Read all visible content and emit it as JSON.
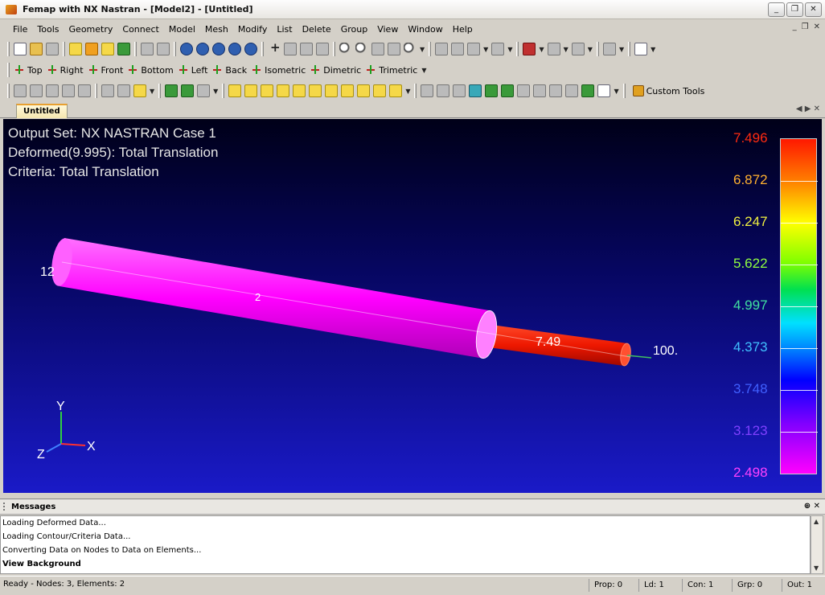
{
  "window": {
    "title": "Femap with NX Nastran - [Model2] - [Untitled]"
  },
  "menu": [
    "File",
    "Tools",
    "Geometry",
    "Connect",
    "Model",
    "Mesh",
    "Modify",
    "List",
    "Delete",
    "Group",
    "View",
    "Window",
    "Help"
  ],
  "views": [
    "Top",
    "Right",
    "Front",
    "Bottom",
    "Left",
    "Back",
    "Isometric",
    "Dimetric",
    "Trimetric"
  ],
  "toolbar": {
    "custom_tools_label": "Custom Tools"
  },
  "tab": {
    "label": "Untitled"
  },
  "viewport": {
    "info_lines": [
      "Output Set: NX NASTRAN Case 1",
      "Deformed(9.995): Total Translation",
      "Criteria: Total Translation"
    ],
    "legend": {
      "values": [
        "7.496",
        "6.872",
        "6.247",
        "5.622",
        "4.997",
        "4.373",
        "3.748",
        "3.123",
        "2.498"
      ],
      "colors": [
        "#ff2a10",
        "#ffb030",
        "#f0f040",
        "#90ff40",
        "#40e0a0",
        "#40c0ff",
        "#4060ff",
        "#8040ff",
        "#ff40ff"
      ]
    },
    "labels": {
      "left_node": "12",
      "mid_elem": "2",
      "right_elem": "7.49",
      "right_node": "100."
    },
    "triad": {
      "x": "X",
      "y": "Y",
      "z": "Z"
    }
  },
  "messages": {
    "title": "Messages",
    "lines": [
      "Loading Deformed Data...",
      "Loading Contour/Criteria Data...",
      "Converting Data on Nodes to Data on Elements...",
      "View Background"
    ]
  },
  "status": {
    "left": "Ready - Nodes: 3, Elements: 2",
    "prop": "Prop: 0",
    "ld": "Ld: 1",
    "con": "Con: 1",
    "grp": "Grp: 0",
    "out": "Out: 1"
  }
}
